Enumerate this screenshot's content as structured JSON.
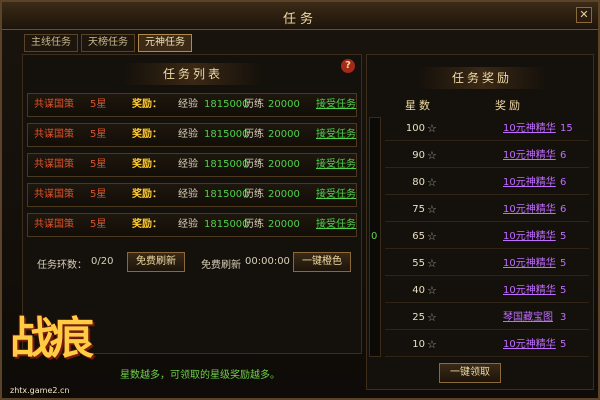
{
  "window": {
    "title": "任务",
    "close": "✕"
  },
  "tabs": [
    {
      "label": "主线任务",
      "active": false
    },
    {
      "label": "天榜任务",
      "active": false
    },
    {
      "label": "元神任务",
      "active": true
    }
  ],
  "task_list": {
    "header": "任务列表",
    "help": "?",
    "rows": [
      {
        "name": "共谋国策",
        "stars": "5星",
        "reward_label": "奖励：",
        "exp_label": "经验",
        "exp": "1815000",
        "xp_label": "历练",
        "xp": "20000",
        "action": "接受任务"
      },
      {
        "name": "共谋国策",
        "stars": "5星",
        "reward_label": "奖励：",
        "exp_label": "经验",
        "exp": "1815000",
        "xp_label": "历练",
        "xp": "20000",
        "action": "接受任务"
      },
      {
        "name": "共谋国策",
        "stars": "5星",
        "reward_label": "奖励：",
        "exp_label": "经验",
        "exp": "1815000",
        "xp_label": "历练",
        "xp": "20000",
        "action": "接受任务"
      },
      {
        "name": "共谋国策",
        "stars": "5星",
        "reward_label": "奖励：",
        "exp_label": "经验",
        "exp": "1815000",
        "xp_label": "历练",
        "xp": "20000",
        "action": "接受任务"
      },
      {
        "name": "共谋国策",
        "stars": "5星",
        "reward_label": "奖励：",
        "exp_label": "经验",
        "exp": "1815000",
        "xp_label": "历练",
        "xp": "20000",
        "action": "接受任务"
      }
    ],
    "footer": {
      "count_label": "任务环数：",
      "count_value": "0/20",
      "paid_refresh": "免费刷新",
      "free_refresh_label": "免费刷新",
      "free_refresh_timer": "00:00:00",
      "one_click_orange": "一键橙色"
    }
  },
  "rewards": {
    "header": "任务奖励",
    "col_star": "星数",
    "col_reward": "奖励",
    "progress_value": "0",
    "progress_fraction": 0,
    "star_icon": "☆",
    "rows": [
      {
        "stars": "100",
        "item": "10元神精华",
        "qty": "15"
      },
      {
        "stars": "90",
        "item": "10元神精华",
        "qty": "6"
      },
      {
        "stars": "80",
        "item": "10元神精华",
        "qty": "6"
      },
      {
        "stars": "75",
        "item": "10元神精华",
        "qty": "6"
      },
      {
        "stars": "65",
        "item": "10元神精华",
        "qty": "5"
      },
      {
        "stars": "55",
        "item": "10元神精华",
        "qty": "5"
      },
      {
        "stars": "40",
        "item": "10元神精华",
        "qty": "5"
      },
      {
        "stars": "25",
        "item": "琴国藏宝图",
        "qty": "3"
      },
      {
        "stars": "10",
        "item": "10元神精华",
        "qty": "5"
      }
    ],
    "claim_button": "一键领取"
  },
  "hint": "星数越多，可领取的星级奖励越多。",
  "logo": {
    "text": "战痕",
    "url": "zhtx.game2.cn"
  },
  "colors": {
    "accent": "#f0dba5",
    "green": "#4fd14a",
    "purple": "#c06cff",
    "red": "#e0542a"
  }
}
